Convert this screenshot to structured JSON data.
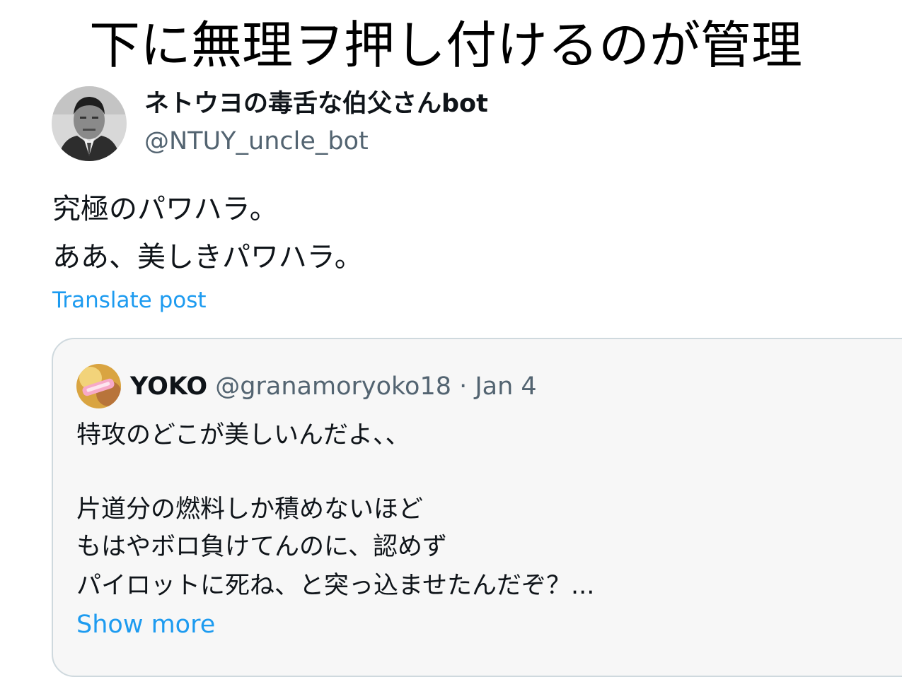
{
  "headline": "下に無理ヲ押し付けるのが管理",
  "post": {
    "author": {
      "display_name": "ネトウヨの毒舌な伯父さんbot",
      "handle": "@NTUY_uncle_bot"
    },
    "lines": [
      "究極のパワハラ。",
      "ああ、美しきパワハラ。"
    ],
    "translate_label": "Translate post"
  },
  "quoted_post": {
    "author": {
      "display_name": "YOKO",
      "meta": "@granamoryoko18 · Jan 4"
    },
    "lines": [
      "特攻のどこが美しいんだよ、、",
      "片道分の燃料しか積めないほど",
      "もはやボロ負けてんのに、認めず",
      "パイロットに死ね、と突っ込ませたんだぞ？..."
    ],
    "show_more_label": "Show more"
  },
  "colors": {
    "link": "#1d9bf0",
    "secondary_text": "#536471",
    "primary_text": "#0f1419",
    "quote_background": "#f7f7f7",
    "quote_border": "#cfd9de"
  }
}
